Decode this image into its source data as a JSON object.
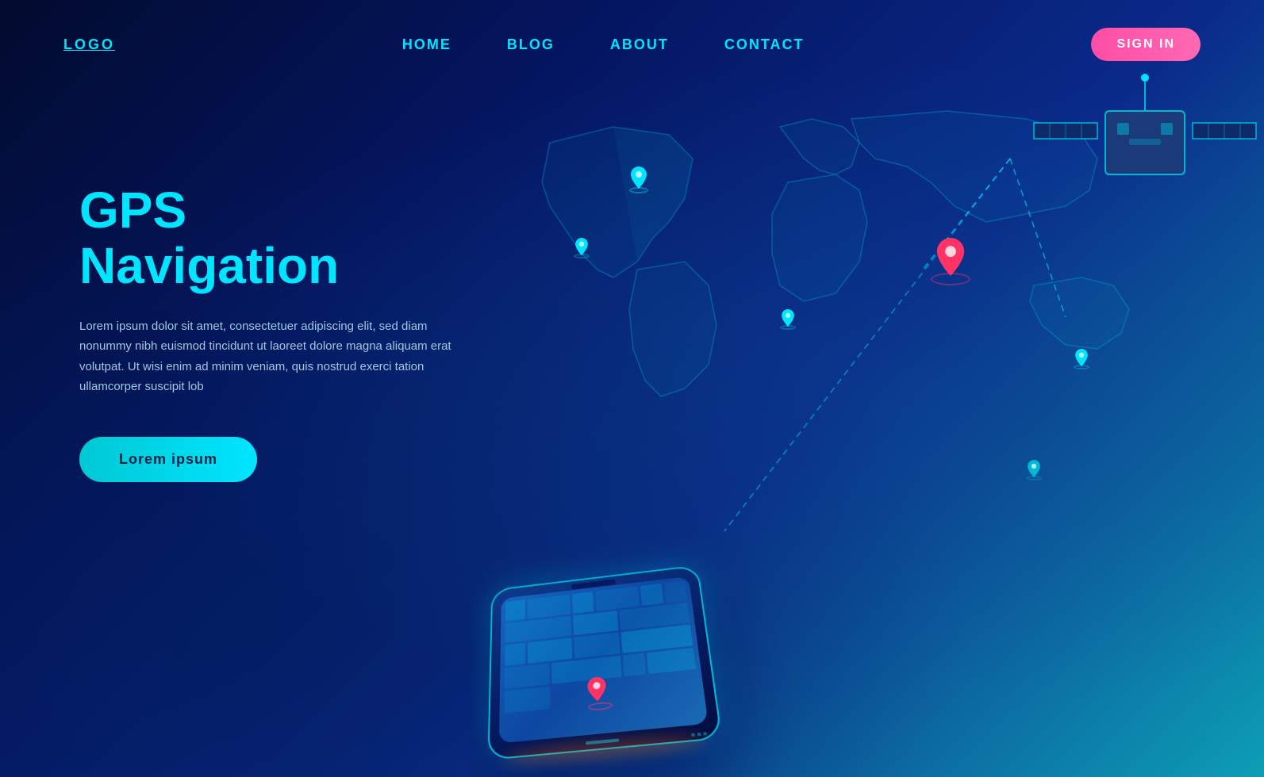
{
  "nav": {
    "logo": "LOGO",
    "home": "HOME",
    "blog": "BLOG",
    "about": "ABOUT",
    "contact": "CONTACT",
    "signin": "SIGN IN"
  },
  "hero": {
    "title": "GPS Navigation",
    "description": "Lorem ipsum dolor sit amet, consectetuer adipiscing elit, sed diam nonummy nibh euismod tincidunt ut laoreet dolore magna aliquam erat volutpat. Ut wisi enim ad minim veniam, quis nostrud exerci tation ullamcorper suscipit lob",
    "cta": "Lorem ipsum"
  },
  "colors": {
    "accent": "#00e5ff",
    "brand_gradient_start": "#020b2e",
    "brand_gradient_end": "#0d9eb5",
    "pin_red": "#ff3366",
    "signin_pink": "#ff4da6"
  }
}
